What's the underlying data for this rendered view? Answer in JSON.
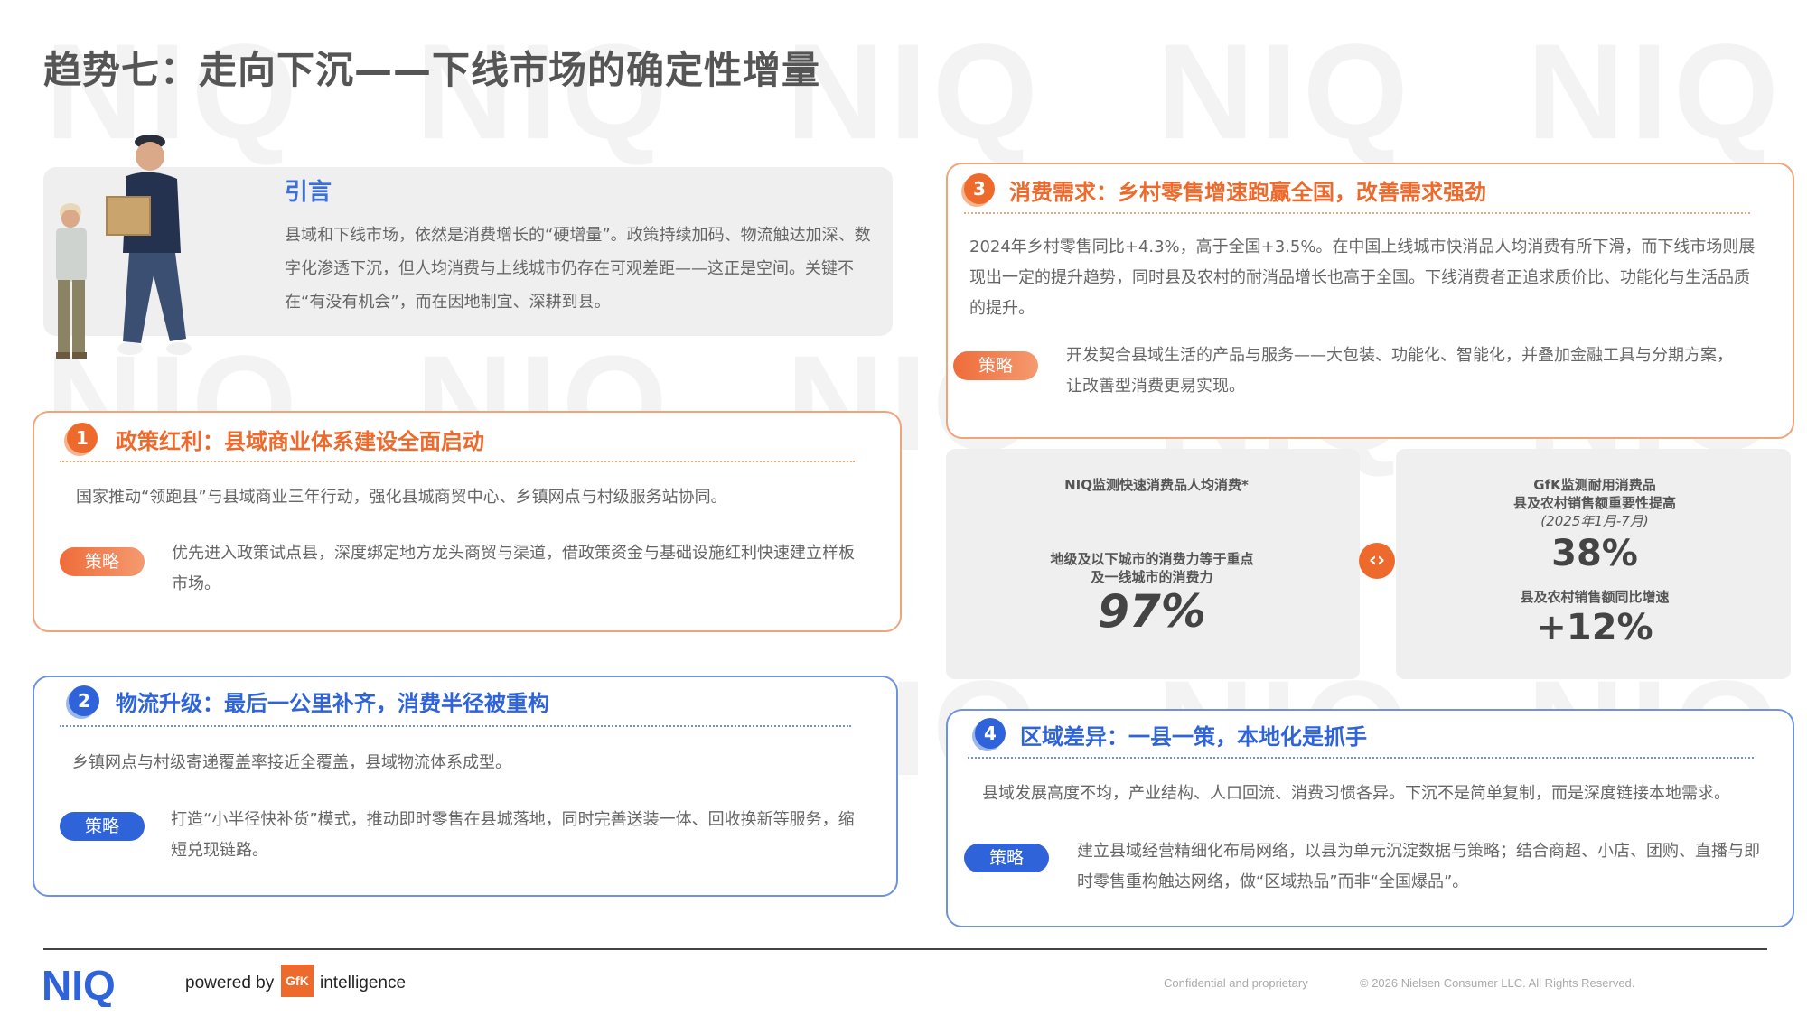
{
  "watermark": "NIQ",
  "title": "趋势七：走向下沉——下线市场的确定性增量",
  "intro": {
    "title": "引言",
    "text": "县域和下线市场，依然是消费增长的“硬增量”。政策持续加码、物流触达加深、数字化渗透下沉，但人均消费与上线城市仍存在可观差距——这正是空间。关键不在“有没有机会”，而在因地制宜、深耕到县。"
  },
  "cards": [
    {
      "number": "1",
      "title": "政策红利：县域商业体系建设全面启动",
      "text": "国家推动“领跑县”与县域商业三年行动，强化县城商贸中心、乡镇网点与村级服务站协同。",
      "strategy_label": "策略",
      "strategy": "优先进入政策试点县，深度绑定地方龙头商贸与渠道，借政策资金与基础设施红利快速建立样板市场。"
    },
    {
      "number": "2",
      "title": "物流升级：最后一公里补齐，消费半径被重构",
      "text": "乡镇网点与村级寄递覆盖率接近全覆盖，县域物流体系成型。",
      "strategy_label": "策略",
      "strategy": "打造“小半径快补货”模式，推动即时零售在县城落地，同时完善送装一体、回收换新等服务，缩短兑现链路。"
    },
    {
      "number": "3",
      "title": "消费需求：乡村零售增速跑赢全国，改善需求强劲",
      "text": "2024年乡村零售同比+4.3%，高于全国+3.5%。在中国上线城市快消品人均消费有所下滑，而下线市场则展现出一定的提升趋势，同时县及农村的耐消品增长也高于全国。下线消费者正追求质价比、功能化与生活品质的提升。",
      "strategy_label": "策略",
      "strategy": "开发契合县域生活的产品与服务——大包装、功能化、智能化，并叠加金融工具与分期方案，让改善型消费更易实现。"
    },
    {
      "number": "4",
      "title": "区域差异：一县一策，本地化是抓手",
      "text": "县域发展高度不均，产业结构、人口回流、消费习惯各异。下沉不是简单复制，而是深度链接本地需求。",
      "strategy_label": "策略",
      "strategy": "建立县域经营精细化布局网络，以县为单元沉淀数据与策略；结合商超、小店、团购、直播与即时零售重构触达网络，做“区域热品”而非“全国爆品”。"
    }
  ],
  "stats": {
    "left": {
      "header": "NIQ监测快速消费品人均消费*",
      "label": "地级及以下城市的消费力等于重点及一线城市的消费力",
      "value": "97%"
    },
    "right": {
      "header_line1": "GfK监测耐用消费品",
      "header_line2": "县及农村销售额重要性提高",
      "header_line3": "(2025年1月-7月)",
      "value1": "38%",
      "label2": "县及农村销售额同比增速",
      "value2": "+12%"
    }
  },
  "footer": {
    "logo": "NIQ",
    "powered_by": "powered by",
    "gfk": "GfK",
    "intelligence": "intelligence",
    "confidential": "Confidential and proprietary",
    "copyright": "© 2026 Nielsen Consumer LLC. All Rights Reserved."
  },
  "colors": {
    "orange": "#ee6a2c",
    "blue": "#2f63d9",
    "gray_box": "#efefef"
  }
}
